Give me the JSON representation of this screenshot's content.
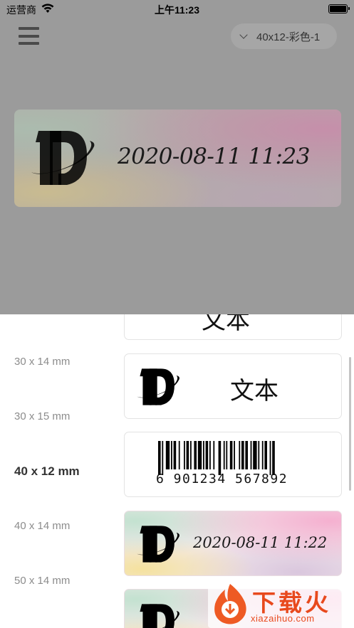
{
  "status_bar": {
    "carrier": "运营商",
    "time": "上午11:23"
  },
  "header": {
    "label_select": "40x12-彩色-1"
  },
  "preview": {
    "date_text": "2020-08-11  11:23"
  },
  "sizes": [
    {
      "label": "30 x 14 mm",
      "selected": false
    },
    {
      "label": "30 x 15 mm",
      "selected": false
    },
    {
      "label": "40 x 12 mm",
      "selected": true
    },
    {
      "label": "40 x 14 mm",
      "selected": false
    },
    {
      "label": "50 x 14 mm",
      "selected": false
    }
  ],
  "templates": {
    "top_partial_text": "文本",
    "logo_text_card_text": "文本",
    "barcode_digits": "6 901234 567892",
    "color_card_date": "2020-08-11  11:22"
  },
  "watermark": {
    "title": "下载火",
    "subtitle": "xiazaihuo.com"
  },
  "icons": {
    "menu": "hamburger-menu-icon",
    "dropdown": "chevron-down-icon",
    "wifi": "wifi-icon",
    "battery": "battery-icon",
    "logo": "dp-logo-icon"
  }
}
